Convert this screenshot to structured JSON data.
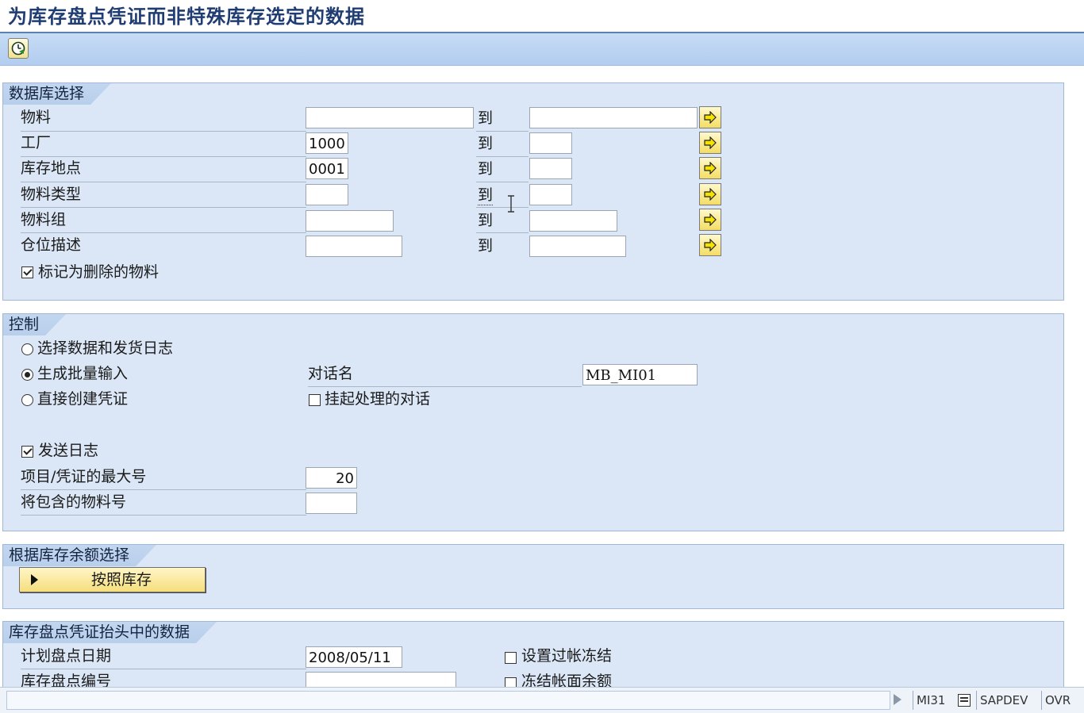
{
  "window": {
    "title": "为库存盘点凭证而非特殊库存选定的数据"
  },
  "toolbar": {
    "execute_icon": "execute-clock-icon"
  },
  "database_selection": {
    "title": "数据库选择",
    "rows": [
      {
        "label": "物料",
        "from": "",
        "to_label": "到",
        "to": ""
      },
      {
        "label": "工厂",
        "from": "1000",
        "to_label": "到",
        "to": ""
      },
      {
        "label": "库存地点",
        "from": "0001",
        "to_label": "到",
        "to": ""
      },
      {
        "label": "物料类型",
        "from": "",
        "to_label": "到",
        "to": ""
      },
      {
        "label": "物料组",
        "from": "",
        "to_label": "到",
        "to": ""
      },
      {
        "label": "仓位描述",
        "from": "",
        "to_label": "到",
        "to": ""
      }
    ],
    "deleted_materials": {
      "label": "标记为删除的物料",
      "checked": true
    }
  },
  "control": {
    "title": "控制",
    "radio_select_data": {
      "label": "选择数据和发货日志",
      "selected": false
    },
    "radio_batch_input": {
      "label": "生成批量输入",
      "selected": true
    },
    "radio_direct_create": {
      "label": "直接创建凭证",
      "selected": false
    },
    "session_name_label": "对话名",
    "session_name_value": "MB_MI01",
    "hold_session": {
      "label": "挂起处理的对话",
      "checked": false
    },
    "send_log": {
      "label": "发送日志",
      "checked": true
    },
    "max_items_label": "项目/凭证的最大号",
    "max_items_value": "20",
    "material_count_label": "将包含的物料号",
    "material_count_value": ""
  },
  "stock_balance": {
    "title": "根据库存余额选择",
    "button_label": "按照库存"
  },
  "header_data": {
    "title": "库存盘点凭证抬头中的数据",
    "planned_date_label": "计划盘点日期",
    "planned_date_value": "2008/05/11",
    "posting_block": {
      "label": "设置过帐冻结",
      "checked": false
    },
    "doc_number_label": "库存盘点编号",
    "doc_number_value": "",
    "freeze_book_inv": {
      "label": "冻结帐面余额",
      "checked": false
    }
  },
  "statusbar": {
    "transaction": "MI31",
    "system": "SAPDEV",
    "mode": "OVR"
  }
}
